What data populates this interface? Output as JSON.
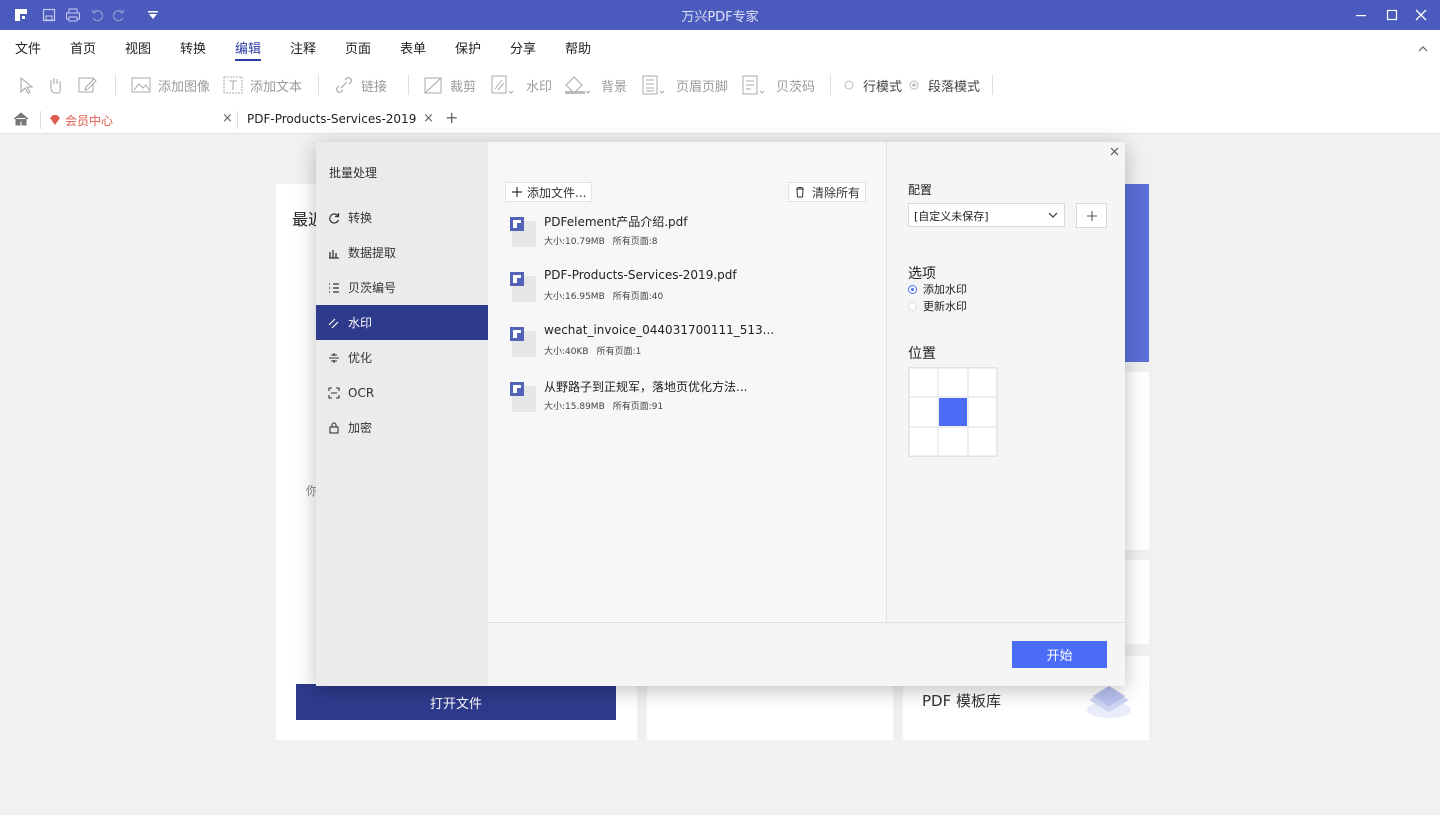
{
  "window": {
    "title": "万兴PDF专家"
  },
  "menu": [
    "文件",
    "首页",
    "视图",
    "转换",
    "编辑",
    "注释",
    "页面",
    "表单",
    "保护",
    "分享",
    "帮助"
  ],
  "menu_active": "编辑",
  "toolbar": {
    "add_image": "添加图像",
    "add_text": "添加文本",
    "link": "链接",
    "crop": "裁剪",
    "watermark": "水印",
    "background": "背景",
    "header_footer": "页眉页脚",
    "bates": "贝茨码",
    "line_mode": "行模式",
    "paragraph_mode": "段落模式"
  },
  "tabs": {
    "member": "会员中心",
    "doc": "PDF-Products-Services-2019"
  },
  "background": {
    "recent": "最近",
    "hint": "你",
    "open_file": "打开文件",
    "template": "PDF 模板库"
  },
  "dialog": {
    "title": "批量处理",
    "side_items": [
      "转换",
      "数据提取",
      "贝茨编号",
      "水印",
      "优化",
      "OCR",
      "加密"
    ],
    "active_item": "水印",
    "add_files": "添加文件...",
    "clear_all": "清除所有",
    "files": [
      {
        "name": "PDFelement产品介绍.pdf",
        "size": "大小:10.79MB",
        "pages": "所有页面:8"
      },
      {
        "name": "PDF-Products-Services-2019.pdf",
        "size": "大小:16.95MB",
        "pages": "所有页面:40"
      },
      {
        "name": "wechat_invoice_044031700111_513...",
        "size": "大小:40KB",
        "pages": "所有页面:1"
      },
      {
        "name": "从野路子到正规军，落地页优化方法...",
        "size": "大小:15.89MB",
        "pages": "所有页面:91"
      }
    ],
    "config_label": "配置",
    "config_value": "[自定义未保存]",
    "options_label": "选项",
    "option_add": "添加水印",
    "option_update": "更新水印",
    "position_label": "位置",
    "start": "开始",
    "accent": "#4a6cf7",
    "active_bg": "#2e3a8c"
  }
}
